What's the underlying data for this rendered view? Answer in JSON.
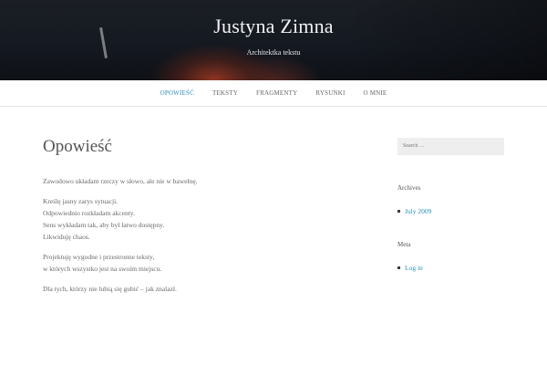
{
  "header": {
    "title": "Justyna Zimna",
    "description": "Architektka tekstu"
  },
  "nav": {
    "items": [
      {
        "label": "OPOWIEŚĆ",
        "active": true
      },
      {
        "label": "TEKSTY",
        "active": false
      },
      {
        "label": "FRAGMENTY",
        "active": false
      },
      {
        "label": "RYSUNKI",
        "active": false
      },
      {
        "label": "O MNIE",
        "active": false
      }
    ]
  },
  "main": {
    "title": "Opowieść",
    "paragraphs": [
      [
        "Zawodowo układam rzeczy w słowo, ale nie w bawełnę."
      ],
      [
        "Kreślę jasny zarys sytuacji.",
        "Odpowiednio rozkładam akcenty.",
        "Sens wykładam tak, aby był łatwo dostępny.",
        "Likwiduję chaos."
      ],
      [
        "Projektuję wygodne i przestronne teksty,",
        "w których wszystko jest na swoim miejscu."
      ],
      [
        "Dla tych, którzy nie lubią się gubić – jak znalazł."
      ]
    ]
  },
  "sidebar": {
    "search_placeholder": "Search …",
    "archives_title": "Archives",
    "archives": [
      "July 2009"
    ],
    "meta_title": "Meta",
    "meta_links": [
      "Log in"
    ]
  },
  "colors": {
    "accent": "#2a8fb8",
    "text": "#6a6a6a",
    "hero_bg": "#141820"
  }
}
